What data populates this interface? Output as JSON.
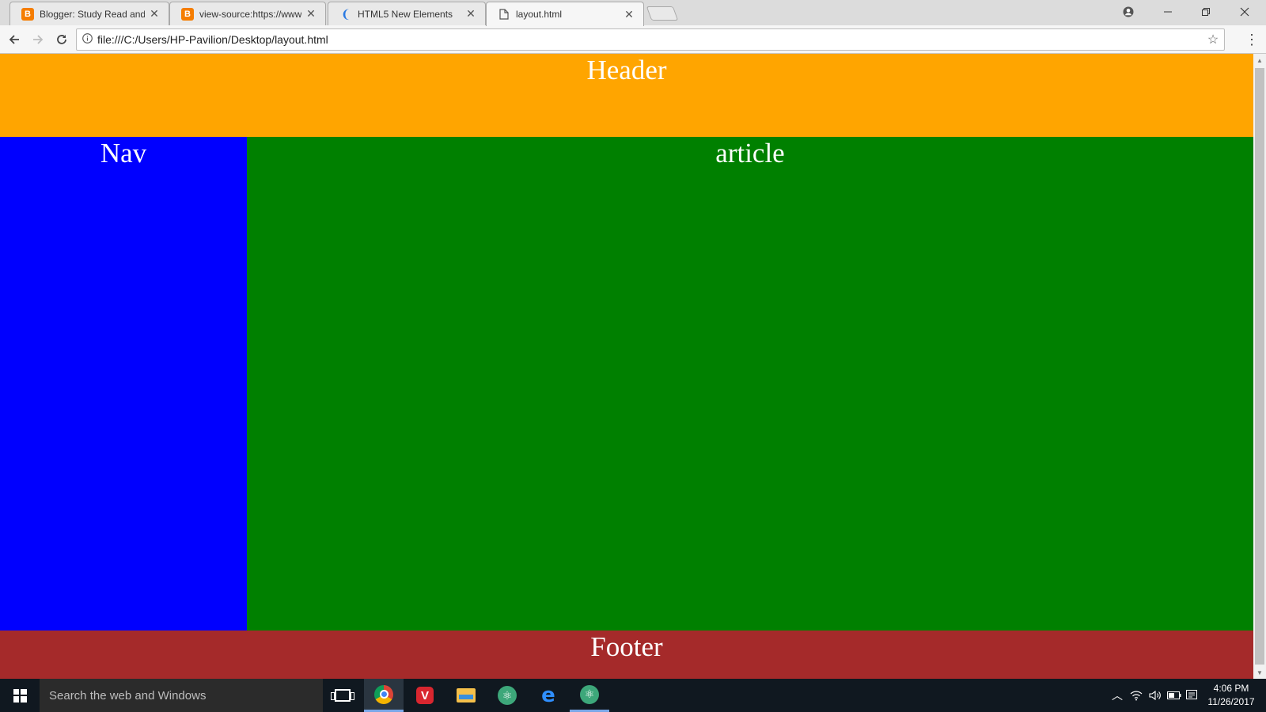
{
  "browser": {
    "tabs": [
      {
        "title": "Blogger: Study Read and",
        "favicon": "blogger-icon"
      },
      {
        "title": "view-source:https://www",
        "favicon": "blogger-icon"
      },
      {
        "title": "HTML5 New Elements",
        "favicon": "w3schools-icon"
      },
      {
        "title": "layout.html",
        "favicon": "file-icon"
      }
    ],
    "active_tab": 3,
    "address": "file:///C:/Users/HP-Pavilion/Desktop/layout.html"
  },
  "page": {
    "header": "Header",
    "nav": "Nav",
    "article": "article",
    "footer": "Footer",
    "colors": {
      "header": "#ffa500",
      "nav": "#0000ff",
      "article": "#008000",
      "footer": "#a52a2a"
    }
  },
  "taskbar": {
    "search_placeholder": "Search the web and Windows",
    "time": "4:06 PM",
    "date": "11/26/2017"
  }
}
